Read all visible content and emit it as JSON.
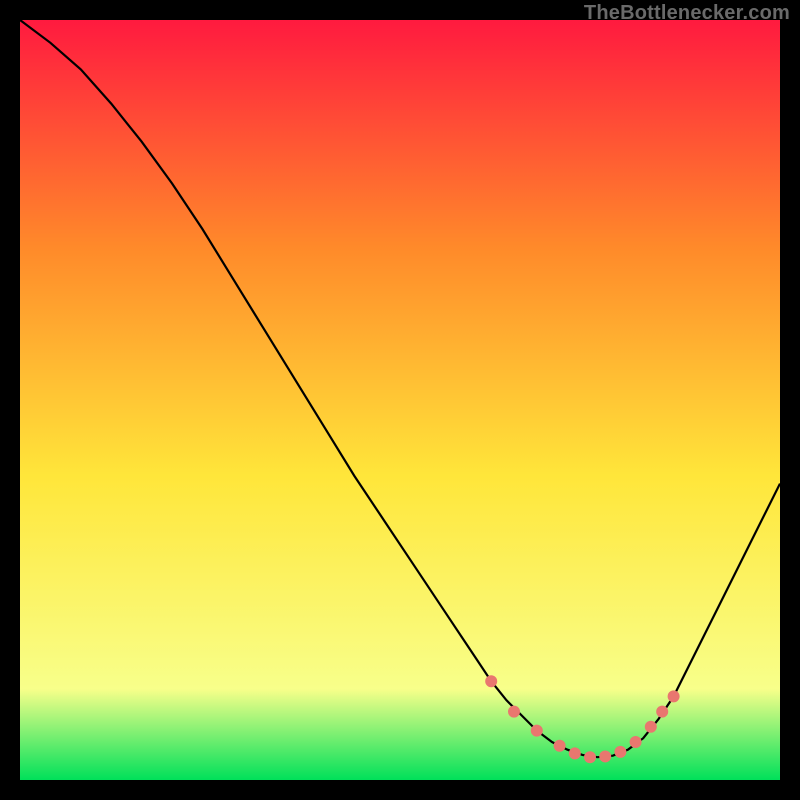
{
  "watermark": "TheBottlenecker.com",
  "colors": {
    "gradient_top": "#ff1a3f",
    "gradient_upper_mid": "#ff8a2a",
    "gradient_mid": "#ffe63a",
    "gradient_lower": "#f8ff8a",
    "gradient_bottom": "#00e05a",
    "curve": "#000000",
    "markers": "#e9776f",
    "frame": "#000000"
  },
  "chart_data": {
    "type": "line",
    "title": "",
    "xlabel": "",
    "ylabel": "",
    "xlim": [
      0,
      100
    ],
    "ylim": [
      0,
      100
    ],
    "series": [
      {
        "name": "bottleneck-curve",
        "x": [
          0,
          4,
          8,
          12,
          16,
          20,
          24,
          28,
          32,
          36,
          40,
          44,
          48,
          52,
          56,
          58,
          60,
          62,
          64,
          66,
          68,
          70,
          72,
          74,
          76,
          78,
          80,
          82,
          84,
          86,
          88,
          90,
          92,
          96,
          100
        ],
        "y": [
          100,
          97,
          93.5,
          89,
          84,
          78.5,
          72.5,
          66,
          59.5,
          53,
          46.5,
          40,
          34,
          28,
          22,
          19,
          16,
          13,
          10.5,
          8.5,
          6.5,
          5,
          4,
          3.3,
          3,
          3.2,
          4,
          5.5,
          8,
          11,
          15,
          19,
          23,
          31,
          39
        ]
      }
    ],
    "markers": {
      "name": "highlight-points",
      "points": [
        {
          "x": 62,
          "y": 13
        },
        {
          "x": 65,
          "y": 9
        },
        {
          "x": 68,
          "y": 6.5
        },
        {
          "x": 71,
          "y": 4.5
        },
        {
          "x": 73,
          "y": 3.5
        },
        {
          "x": 75,
          "y": 3
        },
        {
          "x": 77,
          "y": 3.1
        },
        {
          "x": 79,
          "y": 3.7
        },
        {
          "x": 81,
          "y": 5
        },
        {
          "x": 83,
          "y": 7
        },
        {
          "x": 84.5,
          "y": 9
        },
        {
          "x": 86,
          "y": 11
        }
      ]
    }
  }
}
